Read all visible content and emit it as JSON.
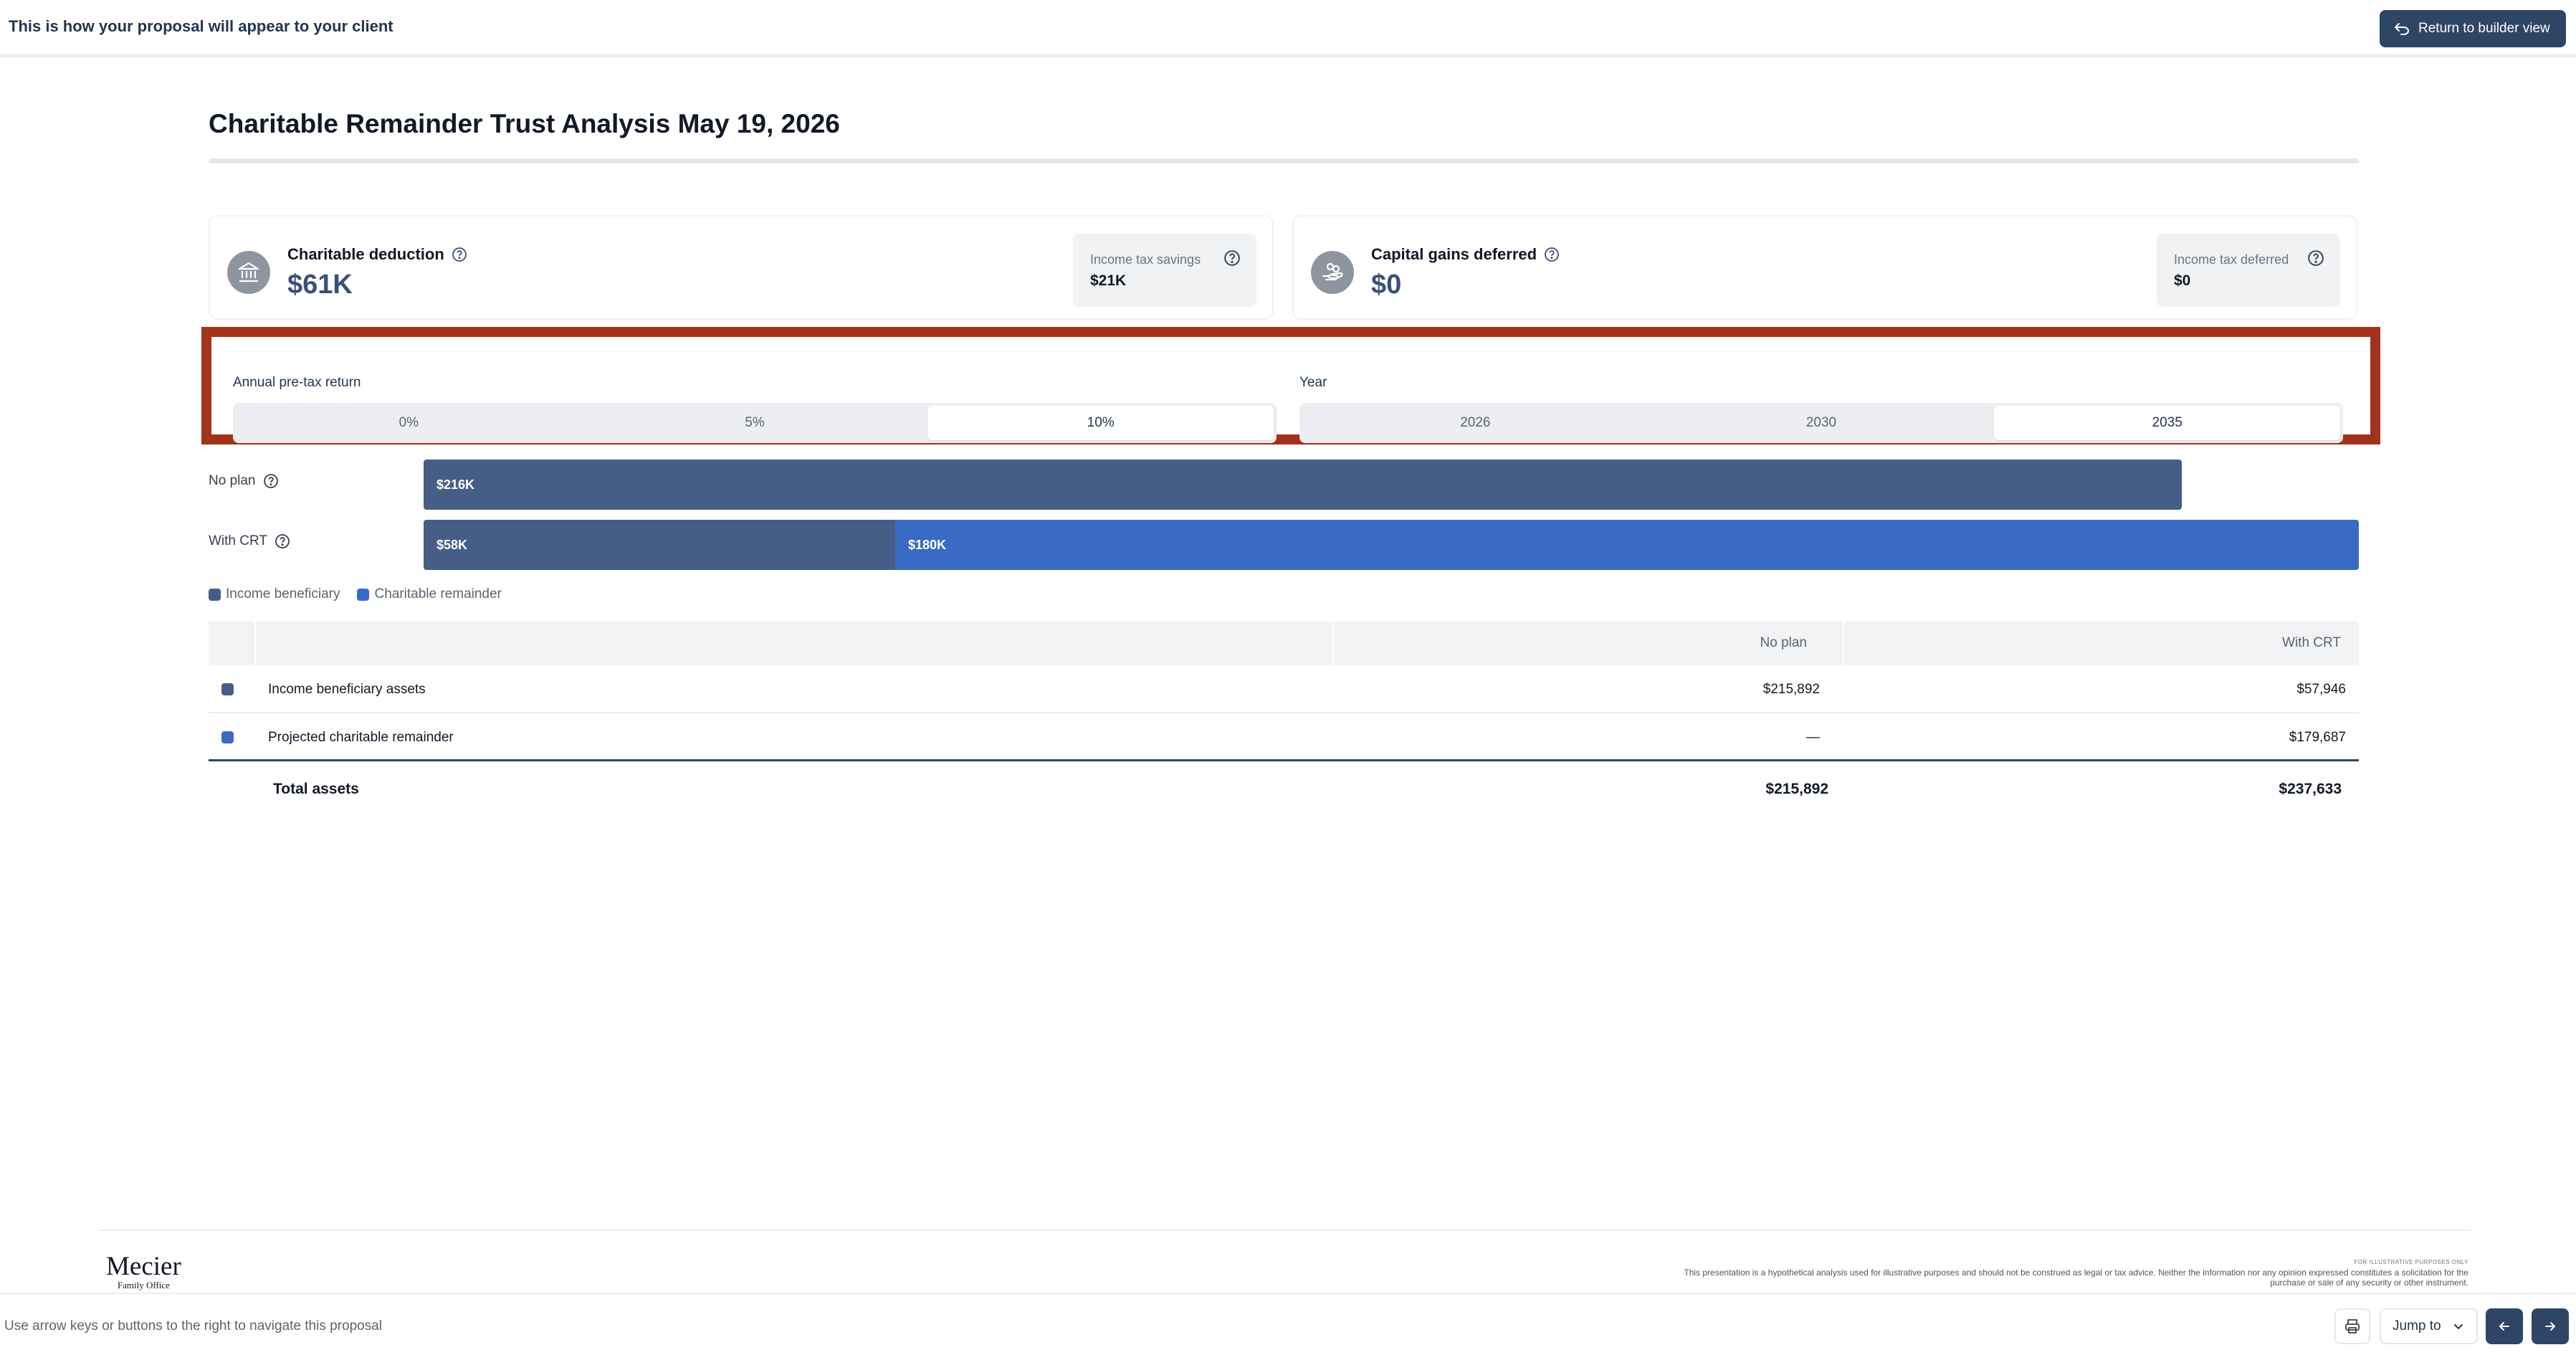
{
  "banner": {
    "text": "This is how your proposal will appear to your client",
    "return_label": "Return to builder view"
  },
  "page": {
    "title": "Charitable Remainder Trust Analysis May 19, 2026"
  },
  "cards": {
    "left": {
      "label": "Charitable deduction",
      "value": "$61K",
      "sub_label": "Income tax savings",
      "sub_value": "$21K",
      "icon": "bank-icon"
    },
    "right": {
      "label": "Capital gains deferred",
      "value": "$0",
      "sub_label": "Income tax deferred",
      "sub_value": "$0",
      "icon": "hand-coins-icon"
    }
  },
  "controls": {
    "return": {
      "label": "Annual pre-tax return",
      "options": [
        "0%",
        "5%",
        "10%"
      ],
      "selected": "10%"
    },
    "year": {
      "label": "Year",
      "options": [
        "2026",
        "2030",
        "2035"
      ],
      "selected": "2035"
    }
  },
  "chart": {
    "rows": [
      {
        "label": "No plan",
        "segments": [
          {
            "label": "$216K",
            "value": 215892,
            "series": "Income beneficiary"
          }
        ]
      },
      {
        "label": "With CRT",
        "segments": [
          {
            "label": "$58K",
            "value": 57946,
            "series": "Income beneficiary"
          },
          {
            "label": "$180K",
            "value": 179687,
            "series": "Charitable remainder"
          }
        ]
      }
    ],
    "legend": [
      "Income beneficiary",
      "Charitable remainder"
    ],
    "colors": {
      "income_beneficiary": "#465e85",
      "charitable_remainder": "#3a6bc4"
    }
  },
  "table": {
    "headers": {
      "no_plan": "No plan",
      "with_crt": "With CRT"
    },
    "rows": [
      {
        "name": "Income beneficiary assets",
        "no_plan": "$215,892",
        "with_crt": "$57,946"
      },
      {
        "name": "Projected charitable remainder",
        "no_plan": "—",
        "with_crt": "$179,687"
      }
    ],
    "total": {
      "name": "Total assets",
      "no_plan": "$215,892",
      "with_crt": "$237,633"
    }
  },
  "footer": {
    "logo_main": "Mecier",
    "logo_sub": "Family Office",
    "disclaimer_tag": "FOR ILLUSTRATIVE PURPOSES ONLY",
    "disclaimer": "This presentation is a hypothetical analysis used for illustrative purposes and should not be construed as legal or tax advice. Neither the information nor any opinion expressed constitutes a solicitation for the purchase or sale of any security or other instrument."
  },
  "nav": {
    "hint": "Use arrow keys or buttons to the right to navigate this proposal",
    "jump_label": "Jump to"
  }
}
